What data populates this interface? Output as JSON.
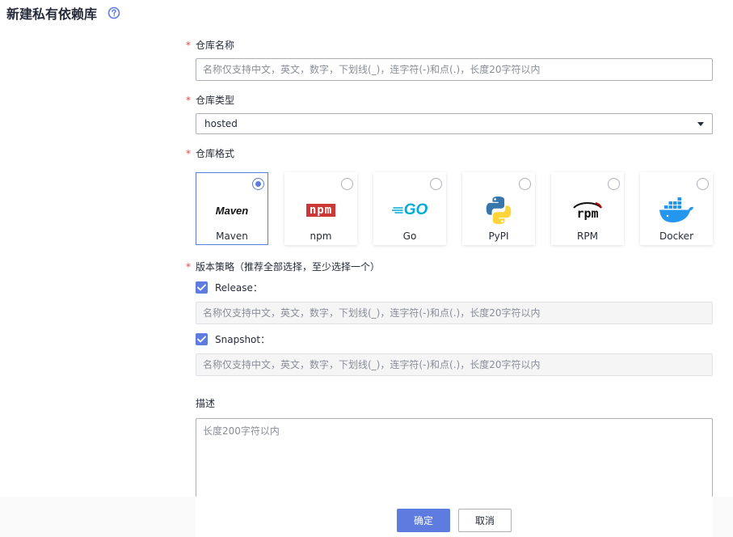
{
  "header": {
    "title": "新建私有依赖库"
  },
  "form": {
    "name": {
      "required_mark": "*",
      "label": "仓库名称",
      "placeholder": "名称仅支持中文，英文，数字，下划线(_)，连字符(-)和点(.)，长度20字符以内"
    },
    "type": {
      "required_mark": "*",
      "label": "仓库类型",
      "value": "hosted"
    },
    "format": {
      "required_mark": "*",
      "label": "仓库格式",
      "options": [
        {
          "name": "Maven",
          "selected": true,
          "icon": "maven-logo"
        },
        {
          "name": "npm",
          "selected": false,
          "icon": "npm-logo"
        },
        {
          "name": "Go",
          "selected": false,
          "icon": "go-logo"
        },
        {
          "name": "PyPI",
          "selected": false,
          "icon": "python-logo"
        },
        {
          "name": "RPM",
          "selected": false,
          "icon": "rpm-logo"
        },
        {
          "name": "Docker",
          "selected": false,
          "icon": "docker-logo"
        }
      ],
      "maven_logo_text": "Maven",
      "npm_logo_text": "npm",
      "go_logo_text": "GO",
      "rpm_logo_text": "rpm"
    },
    "version_policy": {
      "required_mark": "*",
      "label": "版本策略（推荐全部选择，至少选择一个）",
      "release": {
        "label": "Release：",
        "checked": true,
        "placeholder": "名称仅支持中文，英文，数字，下划线(_)，连字符(-)和点(.)，长度20字符以内"
      },
      "snapshot": {
        "label": "Snapshot：",
        "checked": true,
        "placeholder": "名称仅支持中文，英文，数字，下划线(_)，连字符(-)和点(.)，长度20字符以内"
      }
    },
    "description": {
      "label": "描述",
      "placeholder": "长度200字符以内"
    }
  },
  "footer": {
    "confirm_label": "确定",
    "cancel_label": "取消"
  },
  "colors": {
    "accent": "#5e7ce0",
    "required": "#e54545",
    "text": "#252b3a",
    "placeholder": "#8a8e99"
  }
}
